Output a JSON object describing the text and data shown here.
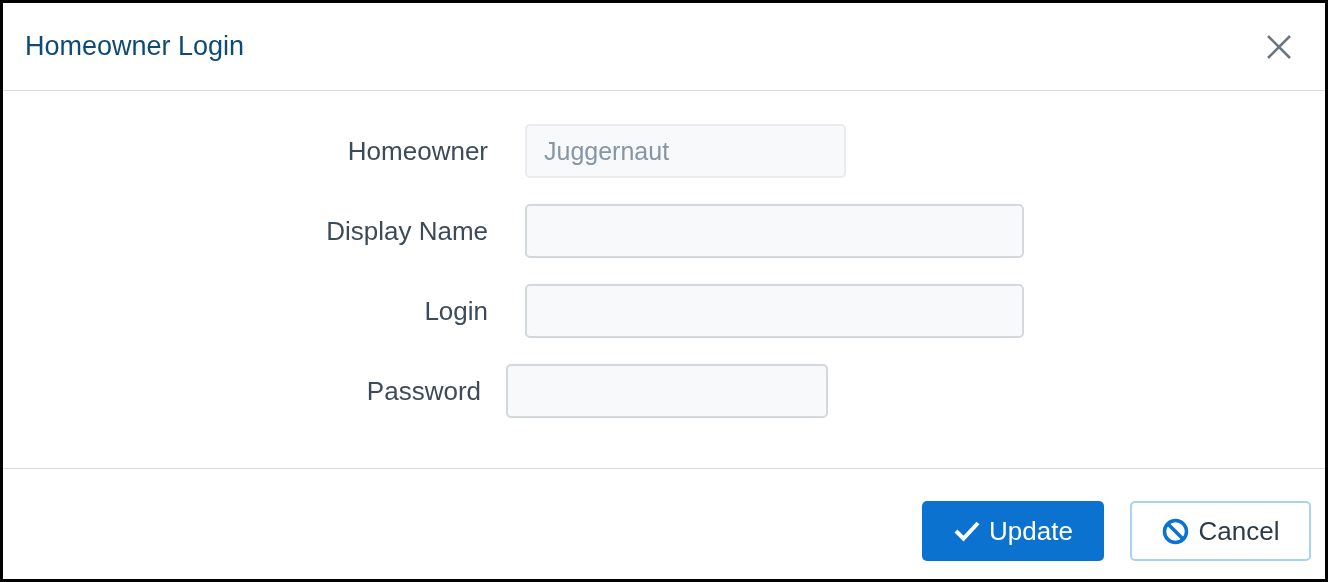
{
  "dialog": {
    "title": "Homeowner Login"
  },
  "fields": [
    {
      "kind": "readonly",
      "label": "Homeowner",
      "value": "Juggernaut",
      "disabled": true
    },
    {
      "kind": "text",
      "label": "Display Name",
      "disabled": false
    },
    {
      "kind": "text",
      "label": "Login",
      "disabled": false
    },
    {
      "kind": "password",
      "label": "Password",
      "disabled": false
    }
  ],
  "buttons": [
    {
      "kind": "primary",
      "label": "Update"
    },
    {
      "kind": "secondary",
      "label": "Cancel"
    }
  ]
}
